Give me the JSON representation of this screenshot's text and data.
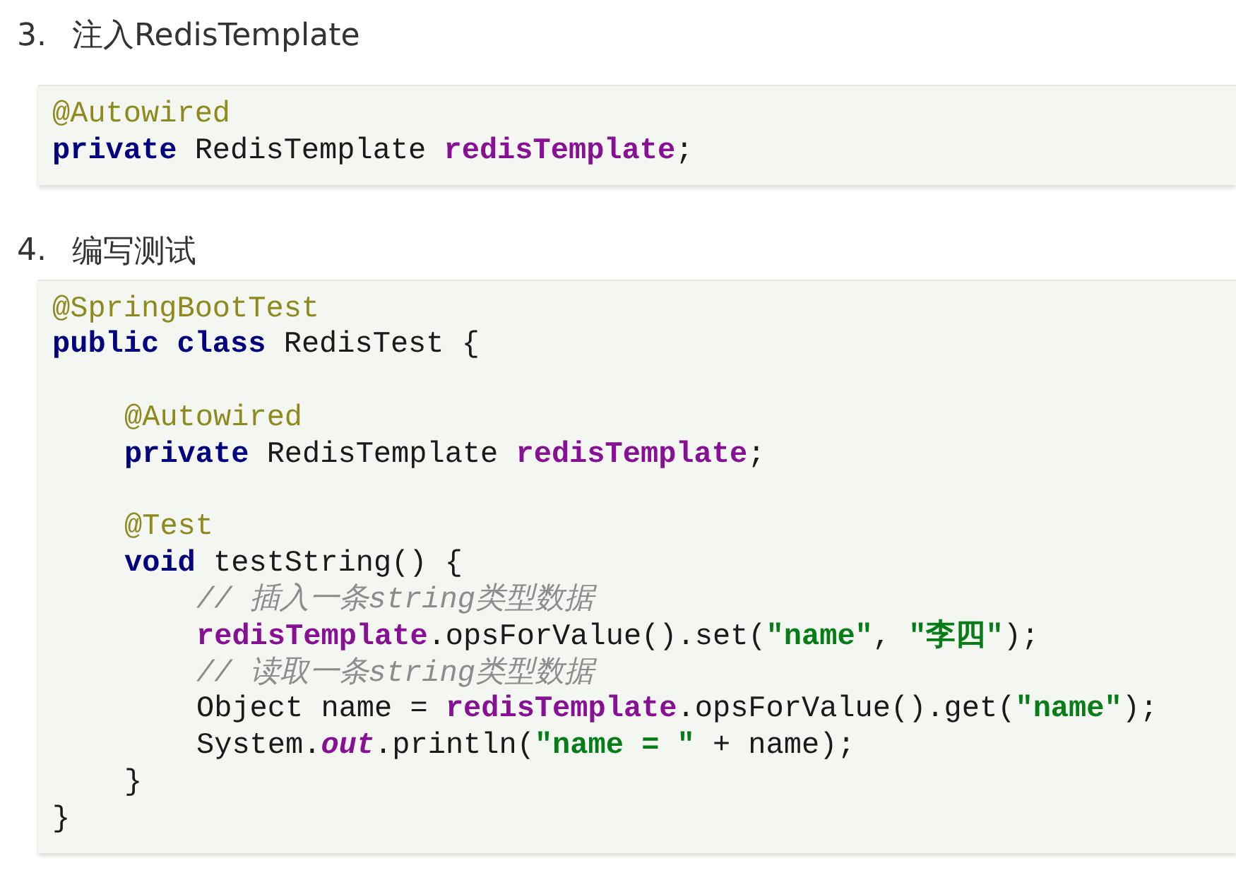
{
  "sections": [
    {
      "number": "3.",
      "title": "注入RedisTemplate",
      "code": [
        {
          "tokens": [
            {
              "kind": "annotation",
              "text": "@Autowired"
            }
          ]
        },
        {
          "tokens": [
            {
              "kind": "keyword",
              "text": "private"
            },
            {
              "kind": "plain",
              "text": " RedisTemplate "
            },
            {
              "kind": "field",
              "text": "redisTemplate"
            },
            {
              "kind": "plain",
              "text": ";"
            }
          ]
        }
      ]
    },
    {
      "number": "4.",
      "title": "编写测试",
      "code": [
        {
          "tokens": [
            {
              "kind": "annotation",
              "text": "@SpringBootTest"
            }
          ]
        },
        {
          "tokens": [
            {
              "kind": "keyword",
              "text": "public class"
            },
            {
              "kind": "plain",
              "text": " RedisTest {"
            }
          ],
          "children": [
            {
              "blank": true
            },
            {
              "tokens": [
                {
                  "kind": "annotation",
                  "text": "@Autowired"
                }
              ]
            },
            {
              "tokens": [
                {
                  "kind": "keyword",
                  "text": "private"
                },
                {
                  "kind": "plain",
                  "text": " RedisTemplate "
                },
                {
                  "kind": "field",
                  "text": "redisTemplate"
                },
                {
                  "kind": "plain",
                  "text": ";"
                }
              ]
            },
            {
              "blank": true
            },
            {
              "tokens": [
                {
                  "kind": "annotation",
                  "text": "@Test"
                }
              ]
            },
            {
              "tokens": [
                {
                  "kind": "keyword",
                  "text": "void"
                },
                {
                  "kind": "plain",
                  "text": " testString() {"
                }
              ],
              "children": [
                {
                  "tokens": [
                    {
                      "kind": "comment",
                      "text": "// 插入一条string类型数据"
                    }
                  ]
                },
                {
                  "tokens": [
                    {
                      "kind": "field",
                      "text": "redisTemplate"
                    },
                    {
                      "kind": "plain",
                      "text": ".opsForValue().set("
                    },
                    {
                      "kind": "string",
                      "text": "\"name\""
                    },
                    {
                      "kind": "plain",
                      "text": ", "
                    },
                    {
                      "kind": "string",
                      "text": "\"李四\""
                    },
                    {
                      "kind": "plain",
                      "text": ");"
                    }
                  ]
                },
                {
                  "tokens": [
                    {
                      "kind": "comment",
                      "text": "// 读取一条string类型数据"
                    }
                  ]
                },
                {
                  "tokens": [
                    {
                      "kind": "plain",
                      "text": "Object name = "
                    },
                    {
                      "kind": "field",
                      "text": "redisTemplate"
                    },
                    {
                      "kind": "plain",
                      "text": ".opsForValue().get("
                    },
                    {
                      "kind": "string",
                      "text": "\"name\""
                    },
                    {
                      "kind": "plain",
                      "text": ");"
                    }
                  ]
                },
                {
                  "tokens": [
                    {
                      "kind": "plain",
                      "text": "System."
                    },
                    {
                      "kind": "static",
                      "text": "out"
                    },
                    {
                      "kind": "plain",
                      "text": ".println("
                    },
                    {
                      "kind": "string",
                      "text": "\"name = \""
                    },
                    {
                      "kind": "plain",
                      "text": " + name);"
                    }
                  ]
                }
              ]
            },
            {
              "tokens": [
                {
                  "kind": "plain",
                  "text": "}"
                }
              ]
            }
          ]
        },
        {
          "tokens": [
            {
              "kind": "plain",
              "text": "}"
            }
          ]
        }
      ]
    }
  ]
}
